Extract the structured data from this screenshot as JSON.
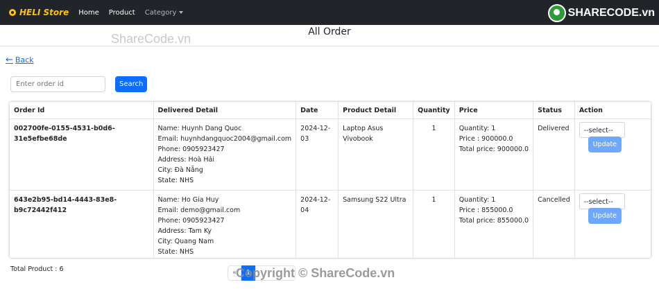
{
  "navbar": {
    "brand": "HELI Store",
    "links": [
      "Home",
      "Product"
    ],
    "category": "Category",
    "watermark_logo": "SHARECODE.vn"
  },
  "page": {
    "title": "All Order",
    "back_label": "Back",
    "watermark_top": "ShareCode.vn",
    "watermark_bottom": "Copyright © ShareCode.vn"
  },
  "search": {
    "placeholder": "Enter order id",
    "button_label": "Search"
  },
  "table": {
    "headers": [
      "Order Id",
      "Delivered Detail",
      "Date",
      "Product Detail",
      "Quantity",
      "Price",
      "Status",
      "Action"
    ],
    "rows": [
      {
        "order_id": "002700fe-0155-4531-b0d6-31e5efbe68de",
        "detail": [
          "Name: Huynh Dang Quoc",
          "Email: huynhdangquoc2004@gmail.com",
          "Phone: 0905923427",
          "Address: Hoà Hải",
          "City: Đà Nẵng",
          "State: NHS"
        ],
        "date": "2024-12-03",
        "product": "Laptop Asus Vivobook",
        "quantity": "1",
        "price": [
          "Quantity: 1",
          "Price : 900000.0",
          "Total price: 900000.0"
        ],
        "status": "Delivered",
        "select": "--select--",
        "update": "Update"
      },
      {
        "order_id": "643e2b95-bd14-4443-83e8-b9c72442f412",
        "detail": [
          "Name: Ho Gia Huy",
          "Email: demo@gmail.com",
          "Phone: 0905923427",
          "Address: Tam Ky",
          "City: Quang Nam",
          "State: NHS"
        ],
        "date": "2024-12-04",
        "product": "Samsung S22 Ultra",
        "quantity": "1",
        "price": [
          "Quantity: 1",
          "Price : 855000.0",
          "Total price: 855000.0"
        ],
        "status": "Cancelled",
        "select": "--select--",
        "update": "Update"
      }
    ]
  },
  "footer": {
    "total": "Total Product : 6",
    "pagination": {
      "prev": "«",
      "current": "1"
    }
  }
}
